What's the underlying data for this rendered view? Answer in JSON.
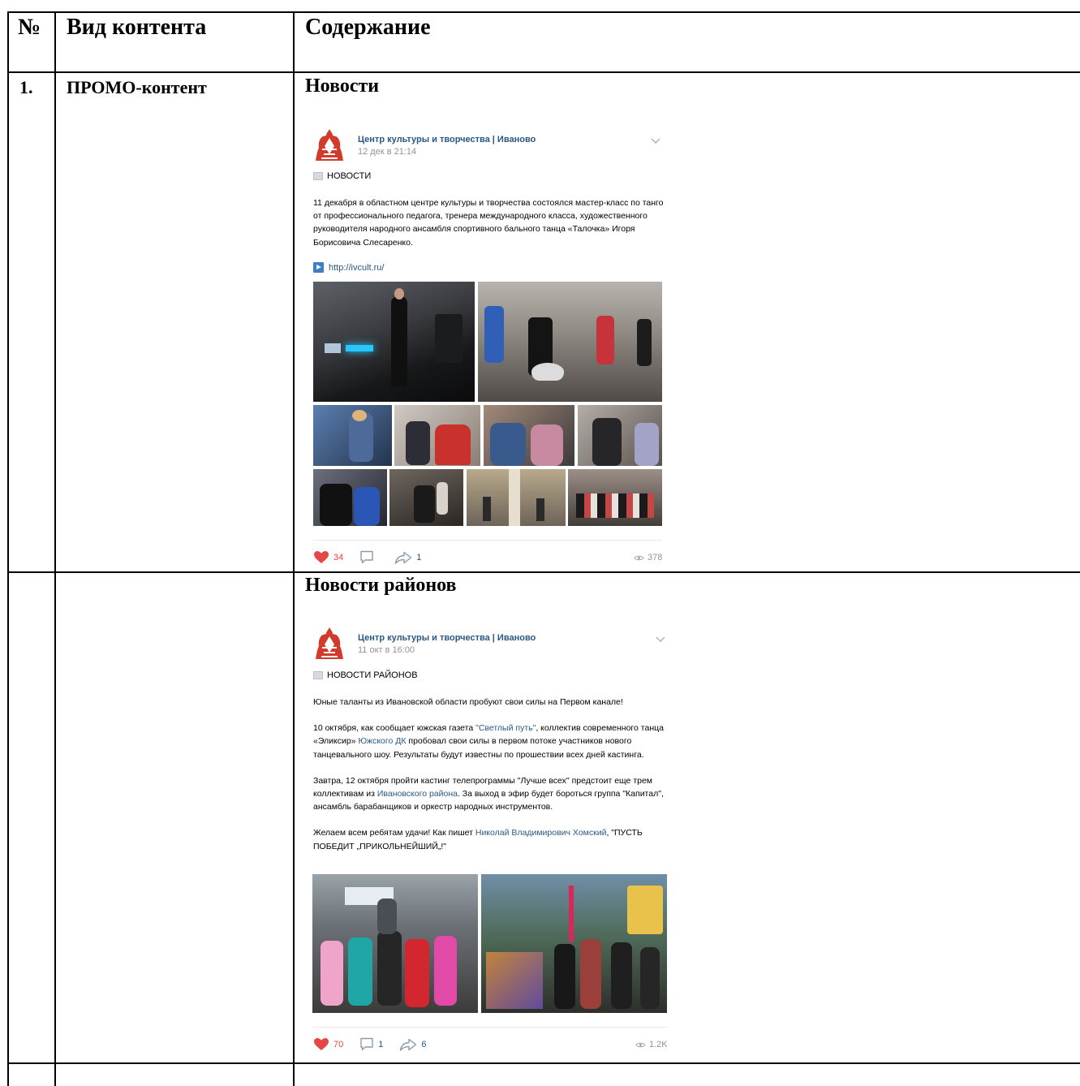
{
  "table": {
    "headers": {
      "num": "№",
      "type": "Вид контента",
      "content": "Содержание"
    },
    "row1": {
      "num": "1.",
      "type": "ПРОМО-контент"
    }
  },
  "sections": [
    {
      "title": "Новости",
      "post": {
        "group_name": "Центр культуры и творчества | Иваново",
        "date": "12 дек в 21:14",
        "tag": "НОВОСТИ",
        "text": "11 декабря в областном центре культуры и творчества состоялся мастер-класс по танго от профессионального педагога, тренера международного класса, художественного руководителя народного ансамбля спортивного бального танца «Талочка» Игоря Борисовича Слесаренко.",
        "link": "http://ivcult.ru/",
        "likes": "34",
        "comments": "",
        "shares": "1",
        "views": "378"
      }
    },
    {
      "title": "Новости районов",
      "post": {
        "group_name": "Центр культуры и творчества | Иваново",
        "date": "11 окт в 16:00",
        "tag": "НОВОСТИ РАЙОНОВ",
        "p1": "Юные таланты из Ивановской области пробуют свои силы на Первом канале!",
        "p2a": "10 октября, как сообщает южская газета ",
        "p2_link1": "\"Светлый путь\"",
        "p2b": ", коллектив современного танца «Эликсир» ",
        "p2_link2": "Южского ДК",
        "p2c": " пробовал свои силы в первом потоке участников нового танцевального шоу. Результаты будут известны по прошествии всех дней кастинга.",
        "p3a": "Завтра, 12 октября пройти кастинг телепрограммы \"Лучше всех\" предстоит еще трем коллективам из ",
        "p3_link": "Ивановского района",
        "p3b": ". За выход в эфир будет бороться группа \"Капитал\", ансамбль барабанщиков и оркестр народных инструментов.",
        "p4a": "Желаем всем ребятам удачи! Как пишет ",
        "p4_link": "Николай Владимирович Хомский",
        "p4b": ", \"ПУСТЬ ПОБЕДИТ „ПРИКОЛЬНЕЙШИЙ„!\"",
        "likes": "70",
        "comments": "1",
        "shares": "6",
        "views": "1.2K"
      }
    }
  ],
  "colors": {
    "vk_link": "#2a5885",
    "like_red": "#e64646",
    "muted": "#939393"
  }
}
